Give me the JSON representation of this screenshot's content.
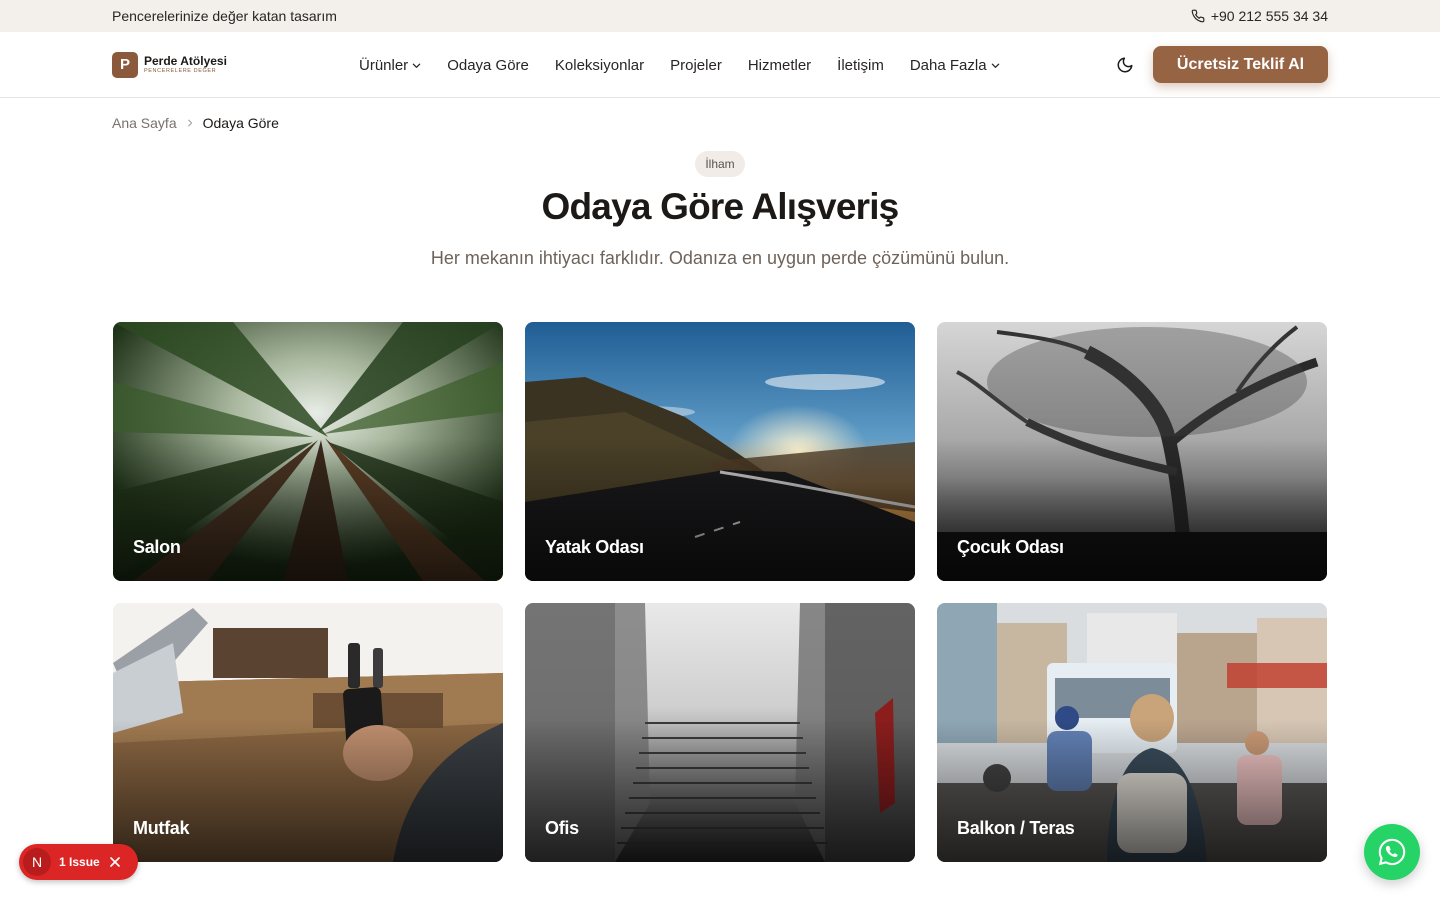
{
  "topbar": {
    "tagline": "Pencerelerinize değer katan tasarım",
    "phone": "+90 212 555 34 34",
    "phone_icon": "phone-icon"
  },
  "header": {
    "logo_letter": "P",
    "logo_name": "Perde Atölyesi",
    "logo_tagline": "PENCERELERE DEĞER",
    "nav": [
      {
        "label": "Ürünler",
        "dropdown": true
      },
      {
        "label": "Odaya Göre",
        "dropdown": false
      },
      {
        "label": "Koleksiyonlar",
        "dropdown": false
      },
      {
        "label": "Projeler",
        "dropdown": false
      },
      {
        "label": "Hizmetler",
        "dropdown": false
      },
      {
        "label": "İletişim",
        "dropdown": false
      },
      {
        "label": "Daha Fazla",
        "dropdown": true
      }
    ],
    "theme_icon": "moon-icon",
    "cta_label": "Ücretsiz Teklif Al"
  },
  "breadcrumb": {
    "home": "Ana Sayfa",
    "current": "Odaya Göre"
  },
  "hero": {
    "badge": "İlham",
    "title": "Odaya Göre Alışveriş",
    "subtitle": "Her mekanın ihtiyacı farklıdır. Odanıza en uygun perde çözümünü bulun."
  },
  "rooms": [
    {
      "label": "Salon",
      "image": "forest canopy looking up"
    },
    {
      "label": "Yatak Odası",
      "image": "mountain road at sunset"
    },
    {
      "label": "Çocuk Odası",
      "image": "black and white misty trees"
    },
    {
      "label": "Mutfak",
      "image": "desk with laptop and phone"
    },
    {
      "label": "Ofis",
      "image": "foggy stone staircase"
    },
    {
      "label": "Balkon / Teras",
      "image": "busy street with scooters"
    }
  ],
  "dev_overlay": {
    "letter": "N",
    "issues": "1 Issue"
  },
  "colors": {
    "accent": "#966343",
    "topbar_bg": "#f3efea",
    "whatsapp": "#25d366",
    "issue_red": "#dc2626"
  }
}
